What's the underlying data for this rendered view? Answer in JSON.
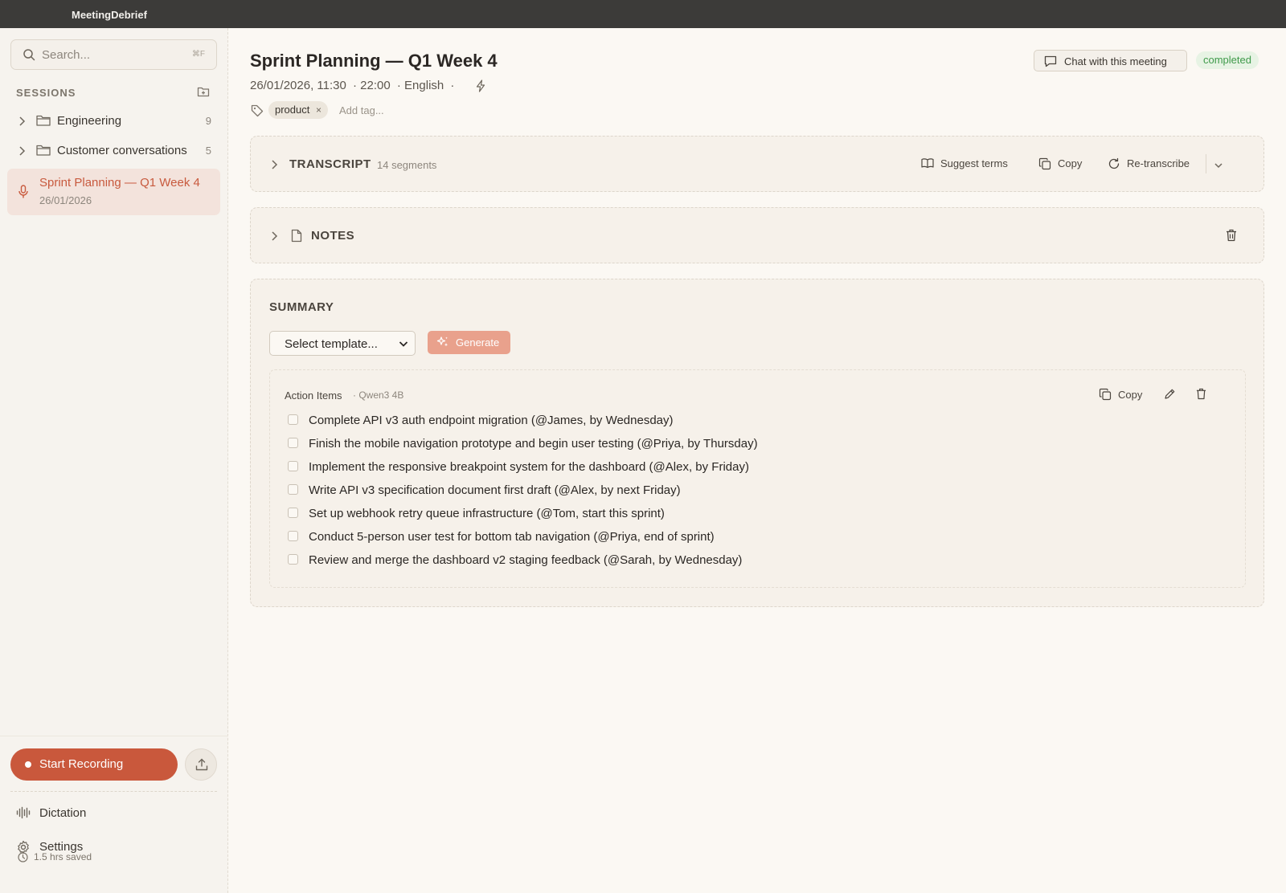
{
  "app": {
    "title": "MeetingDebrief"
  },
  "sidebar": {
    "search_placeholder": "Search...",
    "search_shortcut": "⌘F",
    "sessions_label": "SESSIONS",
    "folders": [
      {
        "name": "Engineering",
        "count": "9"
      },
      {
        "name": "Customer conversations",
        "count": "5"
      }
    ],
    "active_session": {
      "title": "Sprint Planning — Q1 Week 4",
      "date": "26/01/2026"
    },
    "start_recording": "Start Recording",
    "nav": [
      {
        "label": "Dictation",
        "icon": "waveform-icon"
      },
      {
        "label": "Settings",
        "icon": "gear-icon"
      }
    ],
    "time_saved": "1.5 hrs saved"
  },
  "meeting": {
    "title": "Sprint Planning — Q1 Week 4",
    "datetime": "26/01/2026, 11:30",
    "duration": "· 22:00",
    "language": "· English",
    "separator": "·",
    "chat_button": "Chat with this meeting",
    "status": "completed",
    "tags": [
      "product"
    ],
    "tag_remove": "×",
    "add_tag_placeholder": "Add tag..."
  },
  "transcript": {
    "title": "TRANSCRIPT",
    "segments": "14 segments",
    "suggest_terms": "Suggest terms",
    "copy": "Copy",
    "retranscribe": "Re-transcribe"
  },
  "notes": {
    "title": "NOTES"
  },
  "summary": {
    "title": "SUMMARY",
    "template_placeholder": "Select template...",
    "generate": "Generate",
    "card": {
      "title": "Action Items",
      "model": "· Qwen3 4B",
      "copy": "Copy",
      "items": [
        "Complete API v3 auth endpoint migration (@James, by Wednesday)",
        "Finish the mobile navigation prototype and begin user testing (@Priya, by Thursday)",
        "Implement the responsive breakpoint system for the dashboard (@Alex, by Friday)",
        "Write API v3 specification document first draft (@Alex, by next Friday)",
        "Set up webhook retry queue infrastructure (@Tom, start this sprint)",
        "Conduct 5-person user test for bottom tab navigation (@Priya, end of sprint)",
        "Review and merge the dashboard v2 staging feedback (@Sarah, by Wednesday)"
      ]
    }
  },
  "colors": {
    "accent": "#c9583c",
    "accent_light": "#e9a18c",
    "status_green": "#3f9a4a",
    "background": "#fbf8f3",
    "sidebar_bg": "#f6f3ee",
    "titlebar": "#3c3b39"
  }
}
